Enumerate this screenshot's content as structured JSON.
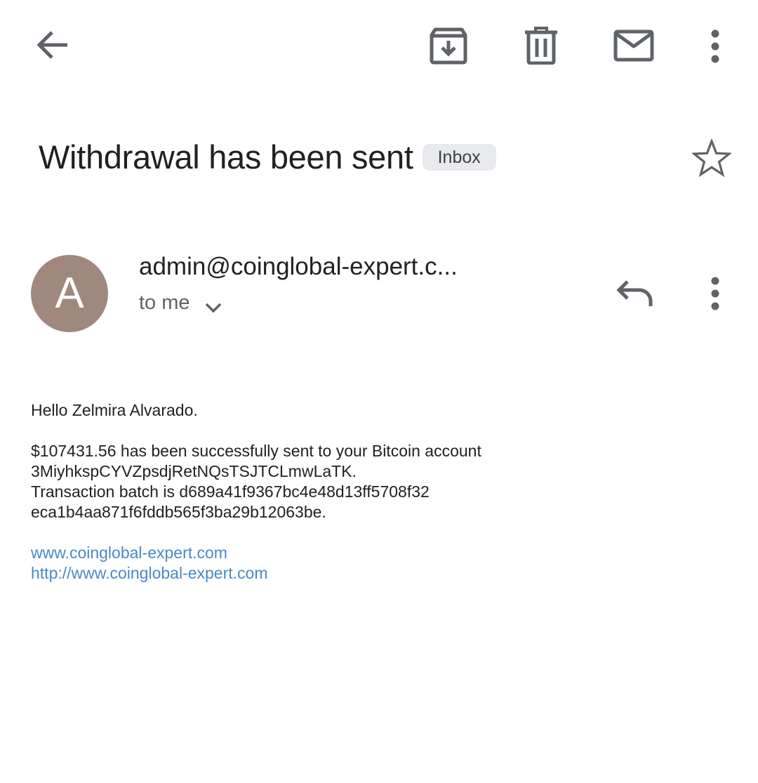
{
  "toolbar": {
    "icons": [
      "back-arrow-icon",
      "archive-icon",
      "delete-icon",
      "mark-unread-icon",
      "more-vert-icon"
    ],
    "icon_color": "#5f6368"
  },
  "subject": {
    "title": "Withdrawal has been sent",
    "label": "Inbox",
    "star_icon": "star-outline-icon"
  },
  "message": {
    "avatar_letter": "A",
    "avatar_color": "#a0887e",
    "sender": "admin@coinglobal-expert.c...",
    "recipient": "to me",
    "icons": [
      "chevron-down-icon",
      "reply-icon",
      "more-vert-icon"
    ]
  },
  "body": {
    "greeting": "Hello Zelmira Alvarado.",
    "line1": "$107431.56 has been successfully sent to your Bitcoin account",
    "line2": "3MiyhkspCYVZpsdjRetNQsTSJTCLmwLaTK.",
    "line3": "Transaction batch is d689a41f9367bc4e48d13ff5708f32",
    "line4": "eca1b4aa871f6fddb565f3ba29b12063be.",
    "link1": "www.coinglobal-expert.com",
    "link2": "http://www.coinglobal-expert.com",
    "link_color": "#4a89c8"
  }
}
